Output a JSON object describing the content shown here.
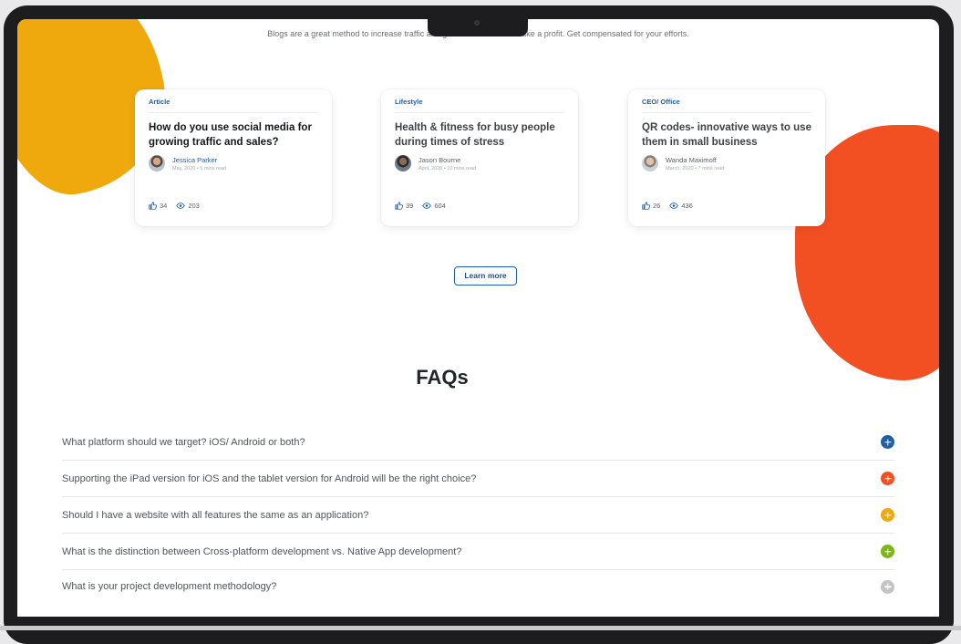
{
  "header": {
    "tagline": "Blogs are a great method to increase traffic and generate leads and make a profit. Get compensated for your efforts."
  },
  "cards": [
    {
      "category": "Article",
      "title": "How do you use social media for growing traffic and sales?",
      "author": "Jessica Parker",
      "meta": "May, 2020 • 5 mins read",
      "likes": "34",
      "views": "203"
    },
    {
      "category": "Lifestyle",
      "title": "Health & fitness for busy people during times of stress",
      "author": "Jason Bourne",
      "meta": "April, 2020 • 10 mins read",
      "likes": "39",
      "views": "604"
    },
    {
      "category": "CEO/ Office",
      "title": "QR codes- innovative ways to use them in small business",
      "author": "Wanda Maximoff",
      "meta": "March, 2020 • 7 mins read",
      "likes": "26",
      "views": "436"
    }
  ],
  "learn_more": "Learn more",
  "faq": {
    "title": "FAQs",
    "items": [
      {
        "question": "What platform should we target? iOS/ Android or both?",
        "color": "#1f5fa8"
      },
      {
        "question": "Supporting the iPad version for iOS and the tablet version for Android will be the right choice?",
        "color": "#f24f22"
      },
      {
        "question": "Should I have a website with all features the same as an application?",
        "color": "#f0a90c"
      },
      {
        "question": "What is the distinction between Cross-platform development vs. Native App development?",
        "color": "#7cb518"
      },
      {
        "question": "What is your project development methodology?",
        "color": "#c4c4c8"
      }
    ]
  },
  "colors": {
    "yellow_blob": "#f0a90c",
    "orange_blob": "#f24f22",
    "accent_blue": "#1f5fa8"
  }
}
